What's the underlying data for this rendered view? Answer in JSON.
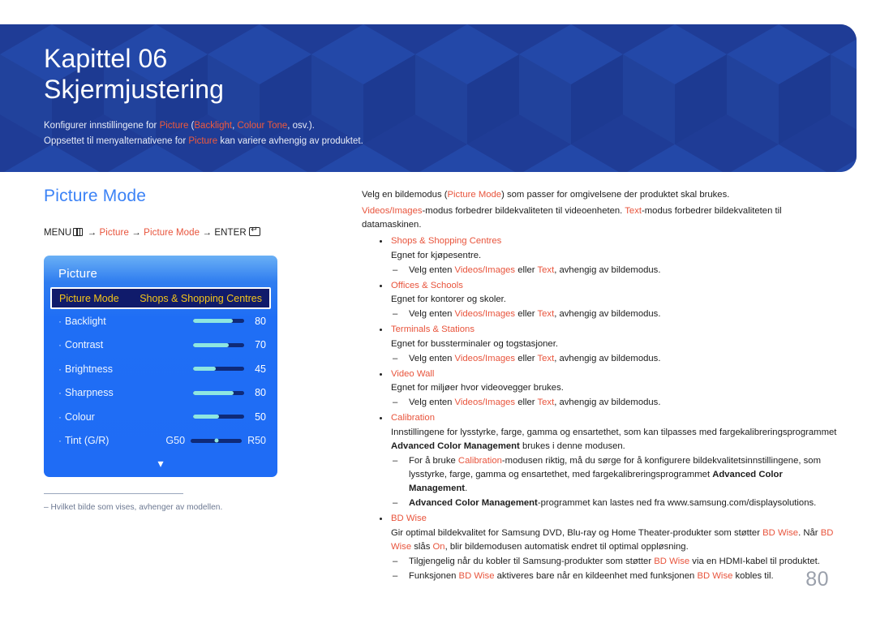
{
  "banner": {
    "chapter_label": "Kapittel 06",
    "chapter_title": "Skjermjustering",
    "desc_line1_a": "Konfigurer innstillingene for ",
    "desc_line1_picture": "Picture",
    "desc_line1_b": " (",
    "desc_line1_backlight": "Backlight",
    "desc_line1_c": ", ",
    "desc_line1_colourtone": "Colour Tone",
    "desc_line1_d": ", osv.).",
    "desc_line2_a": "Oppsettet til menyalternativene for ",
    "desc_line2_picture": "Picture",
    "desc_line2_b": " kan variere avhengig av produktet.",
    "bg_color": "#1f3c96"
  },
  "left": {
    "section_title": "Picture Mode",
    "menu_path": {
      "menu_label": "MENU",
      "arrow1": "→",
      "item1": "Picture",
      "arrow2": "→",
      "item2": "Picture Mode",
      "arrow3": "→",
      "enter_label": "ENTER"
    },
    "osd": {
      "title": "Picture",
      "selected_row": {
        "label": "Picture Mode",
        "value": "Shops & Shopping Centres"
      },
      "rows": [
        {
          "label": "Backlight",
          "value": "80",
          "fill": 78
        },
        {
          "label": "Contrast",
          "value": "70",
          "fill": 70
        },
        {
          "label": "Brightness",
          "value": "45",
          "fill": 45
        },
        {
          "label": "Sharpness",
          "value": "80",
          "fill": 80
        },
        {
          "label": "Colour",
          "value": "50",
          "fill": 50
        }
      ],
      "tint_row": {
        "label": "Tint (G/R)",
        "left_edge": "G50",
        "right_edge": "R50"
      },
      "more_icon": "chevron-down"
    },
    "footnote": {
      "text": "–  Hvilket bilde som vises, avhenger av modellen."
    }
  },
  "right": {
    "intro1_a": "Velg en bildemodus (",
    "intro1_pm": "Picture Mode",
    "intro1_b": ") som passer for omgivelsene der produktet skal brukes.",
    "intro2_vi": "Videos/Images",
    "intro2_a": "-modus forbedrer bildekvaliteten til videoenheten. ",
    "intro2_text": "Text",
    "intro2_b": "-modus forbedrer bildekvaliteten til datamaskinen.",
    "choose_a": "Velg enten ",
    "choose_vi": "Videos/Images",
    "choose_b": " eller ",
    "choose_text": "Text",
    "choose_c": ", avhengig av bildemodus.",
    "items": [
      {
        "head": "Shops & Shopping Centres",
        "body": "Egnet for kjøpesentre."
      },
      {
        "head": "Offices & Schools",
        "body": "Egnet for kontorer og skoler."
      },
      {
        "head": "Terminals & Stations",
        "body": "Egnet for bussterminaler og togstasjoner."
      },
      {
        "head": "Video Wall",
        "body": "Egnet for miljøer hvor videovegger brukes."
      }
    ],
    "calibration": {
      "head": "Calibration",
      "body_a": "Innstillingene for lysstyrke, farge, gamma og ensartethet, som kan tilpasses med fargekalibreringsprogrammet ",
      "body_acm": "Advanced Color Management",
      "body_b": " brukes i denne modusen.",
      "sub1_a": "For å bruke ",
      "sub1_cal": "Calibration",
      "sub1_b": "-modusen riktig, må du sørge for å konfigurere bildekvalitetsinnstillingene, som lysstyrke, farge, gamma og ensartethet, med fargekalibreringsprogrammet ",
      "sub1_acm": "Advanced Color Management",
      "sub1_c": ".",
      "sub2_acm": "Advanced Color Management",
      "sub2_b": "-programmet kan lastes ned fra www.samsung.com/displaysolutions."
    },
    "bdwise": {
      "head": "BD Wise",
      "body_a": "Gir optimal bildekvalitet for Samsung DVD, Blu-ray og Home Theater-produkter som støtter ",
      "body_bd1": "BD Wise",
      "body_b": ". Når ",
      "body_bd2": "BD Wise",
      "body_c": " slås ",
      "body_on": "On",
      "body_d": ", blir bildemodusen automatisk endret til optimal oppløsning.",
      "sub1_a": "Tilgjengelig når du kobler til Samsung-produkter som støtter ",
      "sub1_bd": "BD Wise",
      "sub1_b": " via en HDMI-kabel til produktet.",
      "sub2_a": "Funksjonen ",
      "sub2_bd1": "BD Wise",
      "sub2_b": " aktiveres bare når en kildeenhet med funksjonen ",
      "sub2_bd2": "BD Wise",
      "sub2_c": " kobles til."
    }
  },
  "page_number": "80",
  "colors": {
    "accent_red": "#e8543c",
    "heading_blue": "#3b82f6",
    "banner_blue": "#1f3c96",
    "osd_blue": "#1f6cf5",
    "osd_highlight": "#101b6b",
    "osd_gold": "#f5c518",
    "slider_fill": "#8ee6e0"
  }
}
